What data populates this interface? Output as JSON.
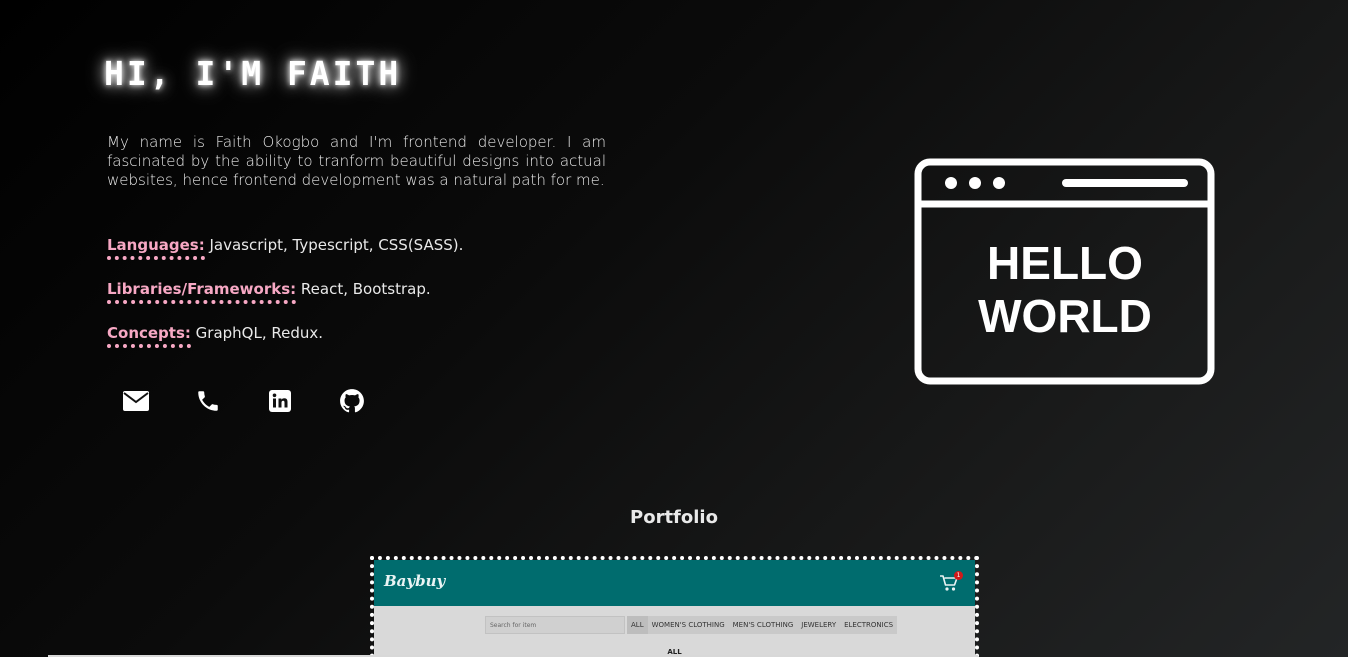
{
  "hero": {
    "title": "HI, I'M FAITH",
    "bio": "My name is Faith Okogbo and I'm frontend developer. I am fascinated by the ability to tranform beautiful designs into actual websites, hence frontend development was a natural path for me."
  },
  "skills": [
    {
      "key": "Languages:",
      "value": " Javascript, Typescript, CSS(SASS)."
    },
    {
      "key": "Libraries/Frameworks:",
      "value": " React, Bootstrap."
    },
    {
      "key": "Concepts:",
      "value": " GraphQL, Redux."
    }
  ],
  "contact": {
    "icons": [
      "mail-icon",
      "phone-icon",
      "linkedin-icon",
      "github-icon"
    ]
  },
  "illustration": {
    "line1": "HELLO",
    "line2": "WORLD"
  },
  "portfolio": {
    "title": "Portfolio",
    "project": {
      "logo": "Baybuy",
      "cart_count": "1",
      "search_placeholder": "Search for item",
      "nav": [
        "ALL",
        "WOMEN'S CLOTHING",
        "MEN'S CLOTHING",
        "JEWELERY",
        "ELECTRONICS"
      ],
      "section_heading": "ALL"
    }
  },
  "colors": {
    "accent_pink": "#f7a8c4",
    "shot_header": "#006c6e"
  }
}
